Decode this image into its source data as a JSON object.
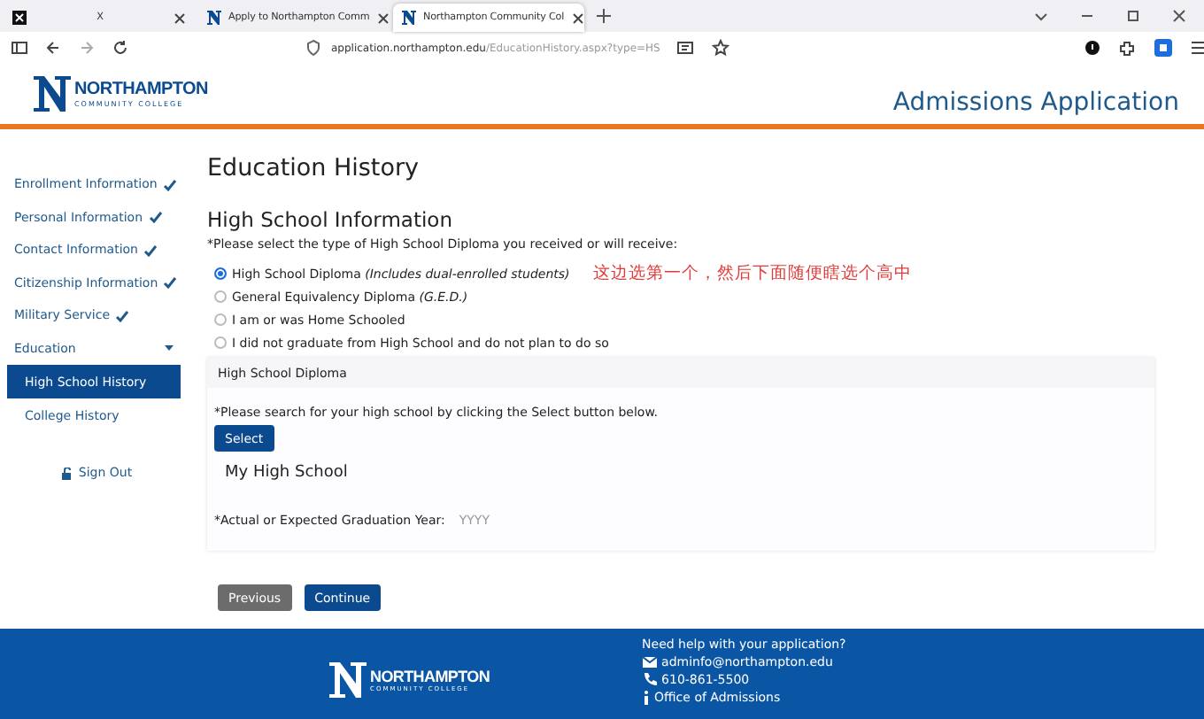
{
  "browser": {
    "tabs": [
      {
        "title": "X",
        "selected": false
      },
      {
        "title": "Apply to Northampton Comm",
        "selected": false
      },
      {
        "title": "Northampton Community Col",
        "selected": true
      }
    ],
    "url_host": "application.northampton.edu",
    "url_path": "/EducationHistory.aspx?type=HS"
  },
  "header": {
    "logo_word": "NORTHAMPTON",
    "logo_sub": "COMMUNITY COLLEGE",
    "title": "Admissions Application"
  },
  "sidebar": {
    "items": [
      {
        "label": "Enrollment Information",
        "checked": true
      },
      {
        "label": "Personal Information",
        "checked": true
      },
      {
        "label": "Contact Information",
        "checked": true
      },
      {
        "label": "Citizenship Information",
        "checked": true
      },
      {
        "label": "Military Service",
        "checked": true
      },
      {
        "label": "Education",
        "checked": false,
        "expanded": true,
        "children": [
          {
            "label": "High School History",
            "selected": true
          },
          {
            "label": "College History",
            "selected": false
          }
        ]
      }
    ],
    "sign_out": "Sign Out"
  },
  "main": {
    "title": "Education History",
    "section": "High School Information",
    "prompt": "*Please select the type of High School Diploma you received or will receive:",
    "options": [
      {
        "label": "High School Diploma",
        "note": "(Includes dual-enrolled students)",
        "selected": true
      },
      {
        "label": "General Equivalency Diploma",
        "note": "(G.E.D.)",
        "selected": false
      },
      {
        "label": "I am or was Home Schooled",
        "selected": false
      },
      {
        "label": "I did not graduate from High School and do not plan to do so",
        "selected": false
      }
    ],
    "annotation": "这边选第一个，然后下面随便瞎选个高中",
    "panel_title": "High School Diploma",
    "search_prompt": "*Please search for your high school by clicking the Select button below.",
    "select_button": "Select",
    "school": "My High School",
    "year_label": "*Actual or Expected Graduation Year:",
    "year_placeholder": "YYYY",
    "buttons": [
      {
        "label": "Previous",
        "kind": "secondary"
      },
      {
        "label": "Continue",
        "kind": "primary"
      }
    ]
  },
  "footer": {
    "logo_word": "NORTHAMPTON",
    "logo_sub": "COMMUNITY COLLEGE",
    "help": "Need help with your application?",
    "contacts": [
      {
        "kind": "email",
        "text": "adminfo@northampton.edu"
      },
      {
        "kind": "phone",
        "text": "610-861-5500"
      },
      {
        "kind": "info",
        "text": "Office of Admissions"
      }
    ]
  }
}
